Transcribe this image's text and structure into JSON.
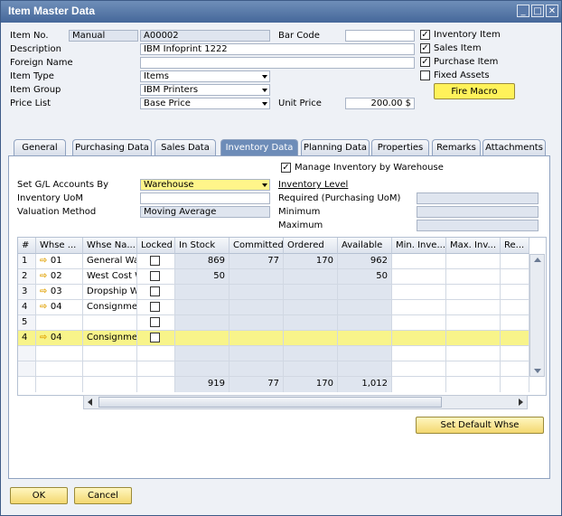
{
  "window": {
    "title": "Item Master Data"
  },
  "header": {
    "item_no_label": "Item No.",
    "item_no_series": "Manual",
    "item_no_value": "A00002",
    "description_label": "Description",
    "description_value": "IBM Infoprint 1222",
    "foreign_name_label": "Foreign Name",
    "foreign_name_value": "",
    "item_type_label": "Item Type",
    "item_type_value": "Items",
    "item_group_label": "Item Group",
    "item_group_value": "IBM Printers",
    "price_list_label": "Price List",
    "price_list_value": "Base Price",
    "bar_code_label": "Bar Code",
    "bar_code_value": "",
    "unit_price_label": "Unit Price",
    "unit_price_value": "200.00 $",
    "inventory_item_label": "Inventory Item",
    "sales_item_label": "Sales Item",
    "purchase_item_label": "Purchase Item",
    "fixed_assets_label": "Fixed Assets",
    "fire_macro_label": "Fire Macro"
  },
  "checkboxes": {
    "inventory_item": true,
    "sales_item": true,
    "purchase_item": true,
    "fixed_assets": false,
    "manage_by_whse": true
  },
  "tabs": [
    "General",
    "Purchasing Data",
    "Sales Data",
    "Inventory Data",
    "Planning Data",
    "Properties",
    "Remarks",
    "Attachments"
  ],
  "inventory": {
    "manage_by_whse_label": "Manage Inventory by Warehouse",
    "set_gl_label": "Set G/L Accounts By",
    "set_gl_value": "Warehouse",
    "uom_label": "Inventory UoM",
    "uom_value": "",
    "valuation_label": "Valuation Method",
    "valuation_value": "Moving Average",
    "inventory_level_label": "Inventory Level",
    "required_label": "Required (Purchasing UoM)",
    "minimum_label": "Minimum",
    "maximum_label": "Maximum"
  },
  "grid": {
    "columns": [
      "#",
      "Whse ...",
      "Whse Na...",
      "Locked",
      "In Stock",
      "Committed",
      "Ordered",
      "Available",
      "Min. Inve...",
      "Max. Inv...",
      "Re..."
    ],
    "rows": [
      {
        "num": "1",
        "whse": "01",
        "name": "General Warel",
        "in_stock": "869",
        "committed": "77",
        "ordered": "170",
        "available": "962",
        "arrow": true
      },
      {
        "num": "2",
        "whse": "02",
        "name": "West Cost W",
        "in_stock": "50",
        "committed": "",
        "ordered": "",
        "available": "50",
        "arrow": true
      },
      {
        "num": "3",
        "whse": "03",
        "name": "Dropship Wa",
        "in_stock": "",
        "committed": "",
        "ordered": "",
        "available": "",
        "arrow": true
      },
      {
        "num": "4",
        "whse": "04",
        "name": "Consignment",
        "in_stock": "",
        "committed": "",
        "ordered": "",
        "available": "",
        "arrow": true
      },
      {
        "num": "5",
        "whse": "",
        "name": "",
        "in_stock": "",
        "committed": "",
        "ordered": "",
        "available": "",
        "arrow": false
      },
      {
        "num": "4",
        "whse": "04",
        "name": "Consignment",
        "in_stock": "",
        "committed": "",
        "ordered": "",
        "available": "",
        "arrow": true
      }
    ],
    "totals": {
      "in_stock": "919",
      "committed": "77",
      "ordered": "170",
      "available": "1,012"
    }
  },
  "buttons": {
    "set_default_whse": "Set Default Whse",
    "ok": "OK",
    "cancel": "Cancel"
  },
  "colors": {
    "title_bar": "#45679a",
    "accent_yellow": "#fff58a",
    "highlight_row": "#f8f48a"
  }
}
